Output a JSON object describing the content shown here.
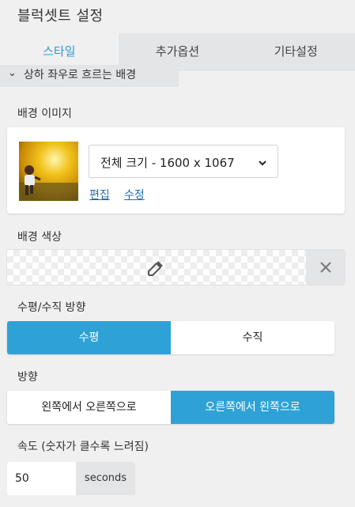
{
  "panel_title": "블럭셋트 설정",
  "tabs": [
    "스타일",
    "추가옵션",
    "기타설정"
  ],
  "section_header": "상하 좌우로 흐르는 배경",
  "background_image": {
    "label": "배경 이미지",
    "size_value": "전체 크기 - 1600 x 1067",
    "edit_link": "편집",
    "modify_link": "수정"
  },
  "background_color": {
    "label": "배경 색상"
  },
  "orientation": {
    "label": "수평/수직 방향",
    "options": [
      "수평",
      "수직"
    ],
    "selected": "수평"
  },
  "direction": {
    "label": "방향",
    "options": [
      "왼쪽에서 오른쪽으로",
      "오른쪽에서 왼쪽으로"
    ],
    "selected": "오른쪽에서 왼쪽으로"
  },
  "speed": {
    "label": "속도 (숫자가 클수록 느려짐)",
    "value": "50",
    "unit": "seconds"
  },
  "colors": {
    "accent": "#2ea2d6",
    "active_tab_text": "#2b9bd3",
    "link": "#2271b1",
    "panel_bg": "#f0f0f1"
  },
  "icons": [
    "chevron-down-icon",
    "eyedropper-icon",
    "close-icon"
  ]
}
